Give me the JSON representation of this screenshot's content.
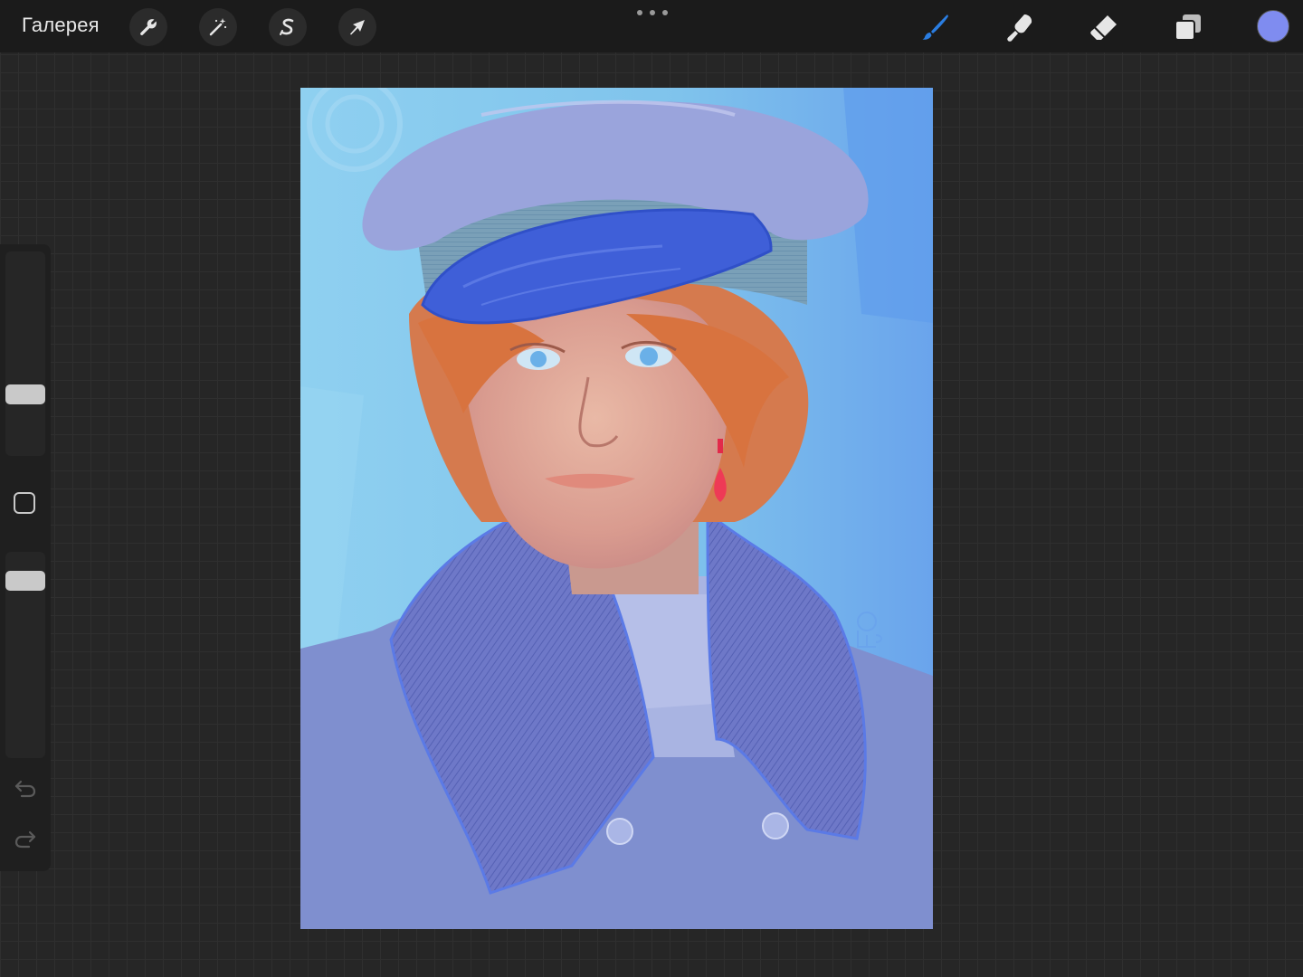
{
  "topbar": {
    "gallery_label": "Галерея",
    "left_tools": [
      {
        "name": "actions",
        "icon": "wrench-icon"
      },
      {
        "name": "adjustments",
        "icon": "magic-wand-icon"
      },
      {
        "name": "selection",
        "icon": "selection-s-icon"
      },
      {
        "name": "transform",
        "icon": "arrow-cursor-icon"
      }
    ],
    "more_icon": "ellipsis-icon",
    "right_tools": [
      {
        "name": "brush",
        "icon": "brush-icon",
        "active": true
      },
      {
        "name": "smudge",
        "icon": "smudge-finger-icon",
        "active": false
      },
      {
        "name": "eraser",
        "icon": "eraser-icon",
        "active": false
      },
      {
        "name": "layers",
        "icon": "layers-icon",
        "active": false
      }
    ],
    "current_color": "#7f8cf0"
  },
  "sidebar": {
    "brush_size_level": 0.28,
    "opacity_level": 0.9,
    "modify_icon": "square-modify-icon",
    "undo_icon": "undo-icon",
    "redo_icon": "redo-icon"
  },
  "canvas": {
    "content": "painting-portrait",
    "signature_icon": "artist-signature-icon"
  },
  "colors": {
    "accent_active_tool": "#2a7de1",
    "topbar_bg": "#1b1b1b",
    "workspace_bg": "#262626",
    "sidebar_bg": "#1f1f1f"
  }
}
